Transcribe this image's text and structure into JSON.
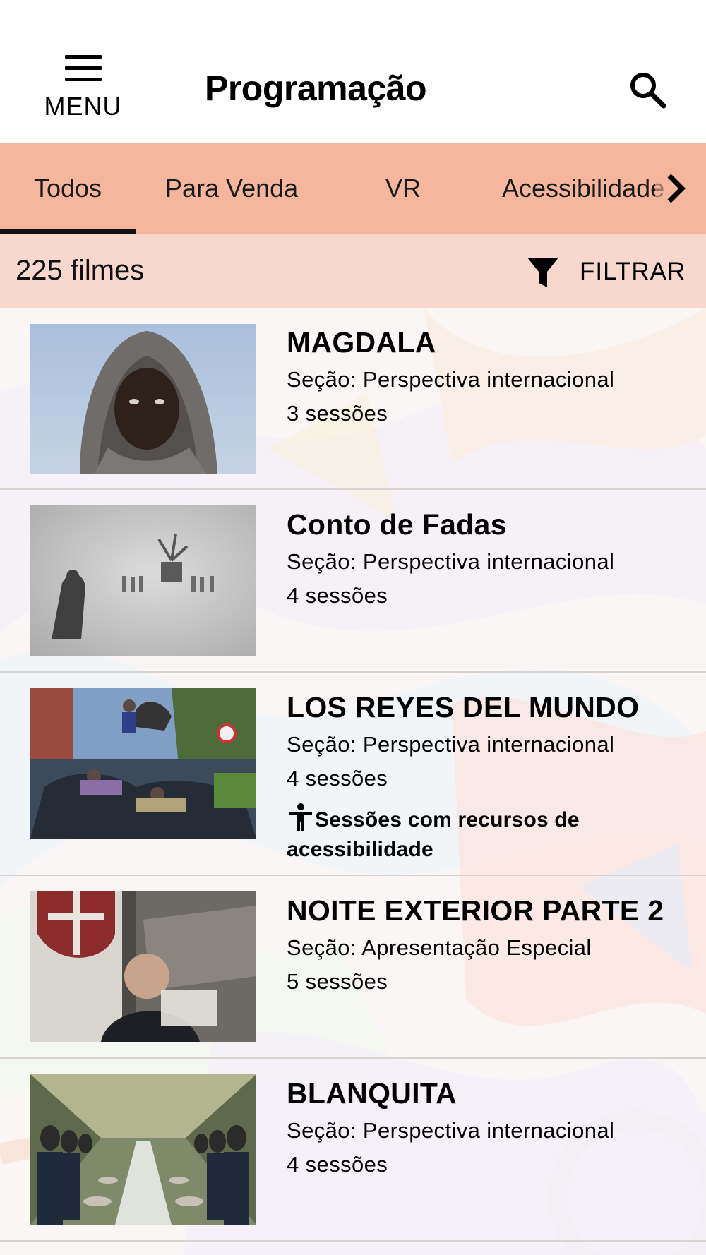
{
  "header": {
    "menu_label": "MENU",
    "title": "Programação",
    "icons": {
      "menu": "hamburger-icon",
      "search": "search-icon"
    }
  },
  "tabs": [
    {
      "label": "Todos",
      "active": true
    },
    {
      "label": "Para Venda",
      "active": false
    },
    {
      "label": "VR",
      "active": false
    },
    {
      "label": "Acessibilidade",
      "active": false
    }
  ],
  "count_bar": {
    "count_text": "225 filmes",
    "filter_label": "FILTRAR",
    "filter_icon": "funnel-icon"
  },
  "films": [
    {
      "title": "MAGDALA",
      "section": "Seção: Perspectiva internacional",
      "sessions": "3 sessões"
    },
    {
      "title": "Conto de Fadas",
      "section": "Seção: Perspectiva internacional",
      "sessions": "4 sessões"
    },
    {
      "title": "LOS REYES DEL MUNDO",
      "section": "Seção: Perspectiva internacional",
      "sessions": "4 sessões",
      "accessibility": "Sessões com recursos de acessibilidade"
    },
    {
      "title": "NOITE EXTERIOR PARTE 2",
      "section": "Seção: Apresentação Especial",
      "sessions": "5 sessões"
    },
    {
      "title": "BLANQUITA",
      "section": "Seção: Perspectiva internacional",
      "sessions": "4 sessões"
    }
  ],
  "colors": {
    "tabs_bg": "#f4b69c",
    "count_bar_bg": "#f8d8cc",
    "indicator": "#111111"
  }
}
